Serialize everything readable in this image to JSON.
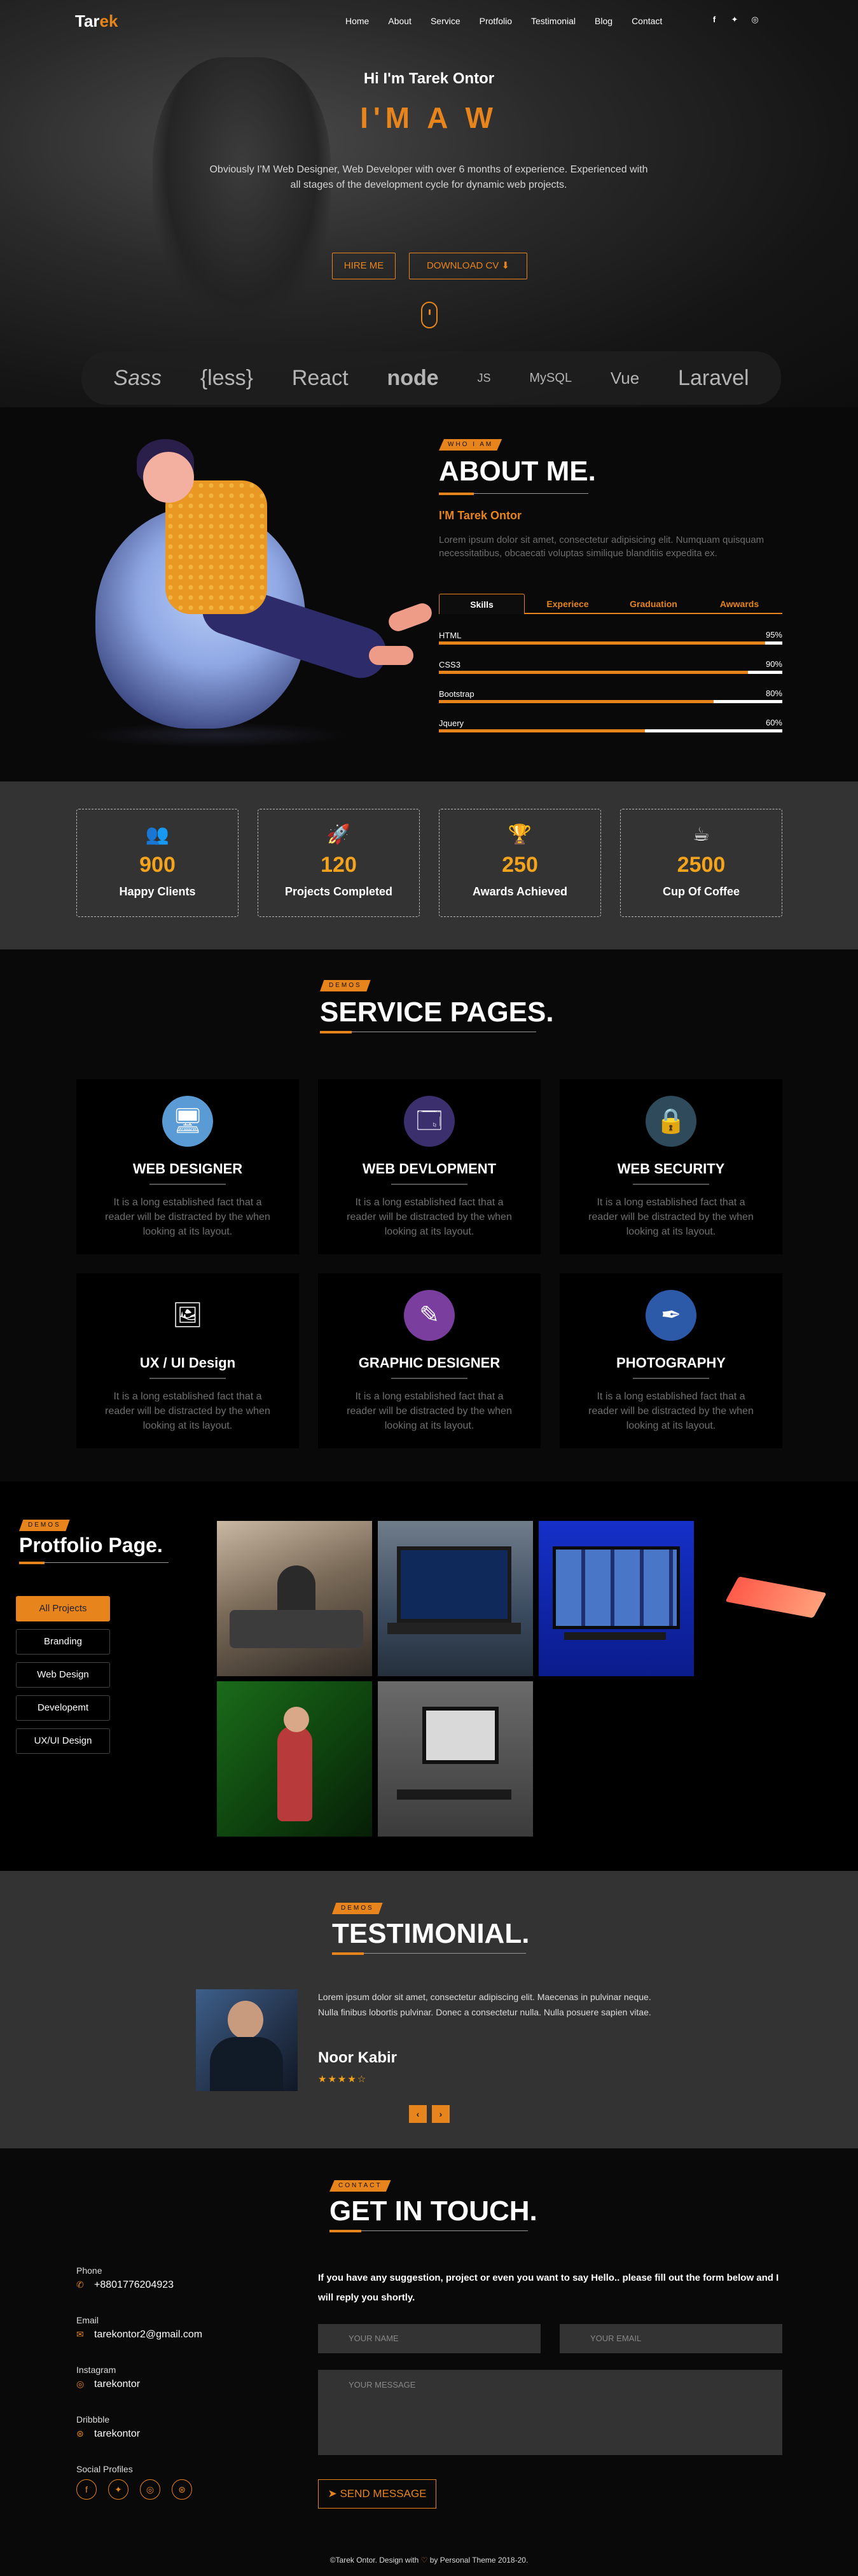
{
  "brand": {
    "logo_part1": "Tar",
    "logo_part2": "ek"
  },
  "nav": {
    "items": [
      "Home",
      "About",
      "Service",
      "Protfolio",
      "Testimonial",
      "Blog",
      "Contact"
    ],
    "social_icons": [
      "facebook-icon",
      "twitter-icon",
      "instagram-icon"
    ]
  },
  "hero": {
    "greeting": "Hi I'm Tarek Ontor",
    "headline": "I'M A W",
    "description": "Obviously I'M Web Designer, Web Developer with over 6 months of experience. Experienced with all stages of the development cycle for dynamic web projects.",
    "hire_button": "HIRE ME",
    "download_button": "DOWNLOAD CV",
    "tech_logos": [
      "Sass",
      "{less}",
      "React",
      "node",
      "JS",
      "MySQL",
      "Vue",
      "Laravel"
    ]
  },
  "about": {
    "tag": "WHO I AM",
    "title": "ABOUT ME.",
    "name": "I'M Tarek Ontor",
    "text": "Lorem ipsum dolor sit amet, consectetur adipisicing elit. Numquam quisquam necessitatibus, obcaecati voluptas similique blanditiis expedita ex.",
    "tabs": [
      "Skills",
      "Experiece",
      "Graduation",
      "Awwards"
    ],
    "skills": [
      {
        "name": "HTML",
        "label": "95%",
        "value": 95
      },
      {
        "name": "CSS3",
        "label": "90%",
        "value": 90
      },
      {
        "name": "Bootstrap",
        "label": "80%",
        "value": 80
      },
      {
        "name": "Jquery",
        "label": "60%",
        "value": 60
      }
    ]
  },
  "counters": [
    {
      "icon": "clients-icon",
      "number": "900",
      "label": "Happy Clients"
    },
    {
      "icon": "rocket-icon",
      "number": "120",
      "label": "Projects Completed"
    },
    {
      "icon": "trophy-icon",
      "number": "250",
      "label": "Awards Achieved"
    },
    {
      "icon": "coffee-icon",
      "number": "2500",
      "label": "Cup Of Coffee"
    }
  ],
  "services": {
    "tag": "DEMOS",
    "title": "SERVICE PAGES.",
    "items": [
      {
        "icon": "monitor-icon",
        "title": "WEB DESIGNER",
        "desc": "It is a long established fact that a reader will be distracted by the when looking at its layout."
      },
      {
        "icon": "code-window-icon",
        "title": "WEB DEVLOPMENT",
        "desc": "It is a long established fact that a reader will be distracted by the when looking at its layout."
      },
      {
        "icon": "lock-icon",
        "title": "WEB SECURITY",
        "desc": "It is a long established fact that a reader will be distracted by the when looking at its layout."
      },
      {
        "icon": "ux-board-icon",
        "title": "UX / UI Design",
        "desc": "It is a long established fact that a reader will be distracted by the when looking at its layout."
      },
      {
        "icon": "pen-tablet-icon",
        "title": "GRAPHIC DESIGNER",
        "desc": "It is a long established fact that a reader will be distracted by the when looking at its layout."
      },
      {
        "icon": "pen-nib-icon",
        "title": "PHOTOGRAPHY",
        "desc": "It is a long established fact that a reader will be distracted by the when looking at its layout."
      }
    ]
  },
  "portfolio": {
    "tag": "DEMOS",
    "title": "Protfolio Page.",
    "filters": [
      "All Projects",
      "Branding",
      "Web Design",
      "Developemt",
      "UX/UI Design"
    ]
  },
  "testimonial": {
    "tag": "DEMOS",
    "title": "TESTIMONIAL.",
    "quote": "Lorem ipsum dolor sit amet, consectetur adipiscing elit. Maecenas in pulvinar neque. Nulla finibus lobortis pulvinar. Donec a consectetur nulla. Nulla posuere sapien vitae.",
    "name": "Noor Kabir",
    "stars": "★★★★☆",
    "prev": "‹",
    "next": "›"
  },
  "contact": {
    "tag": "CONTACT",
    "title": "GET IN TOUCH.",
    "phone_label": "Phone",
    "phone": "+8801776204923",
    "email_label": "Email",
    "email": "tarekontor2@gmail.com",
    "instagram_label": "Instagram",
    "instagram": "tarekontor",
    "dribbble_label": "Dribbble",
    "dribbble": "tarekontor",
    "social_label": "Social Profiles",
    "intro": "If you have any suggestion, project or even you want to say Hello.. please fill out the form below and I will reply you shortly.",
    "name_placeholder": "YOUR NAME",
    "email_placeholder": "YOUR EMAIL",
    "message_placeholder": "YOUR MESSAGE",
    "send_button": "SEND MESSAGE"
  },
  "footer": {
    "text_before": "©Tarek Ontor. Design with",
    "text_after": "by Personal Theme 2018-20."
  },
  "colors": {
    "accent": "#e7841c",
    "dark": "#090909",
    "mid": "#333333"
  }
}
